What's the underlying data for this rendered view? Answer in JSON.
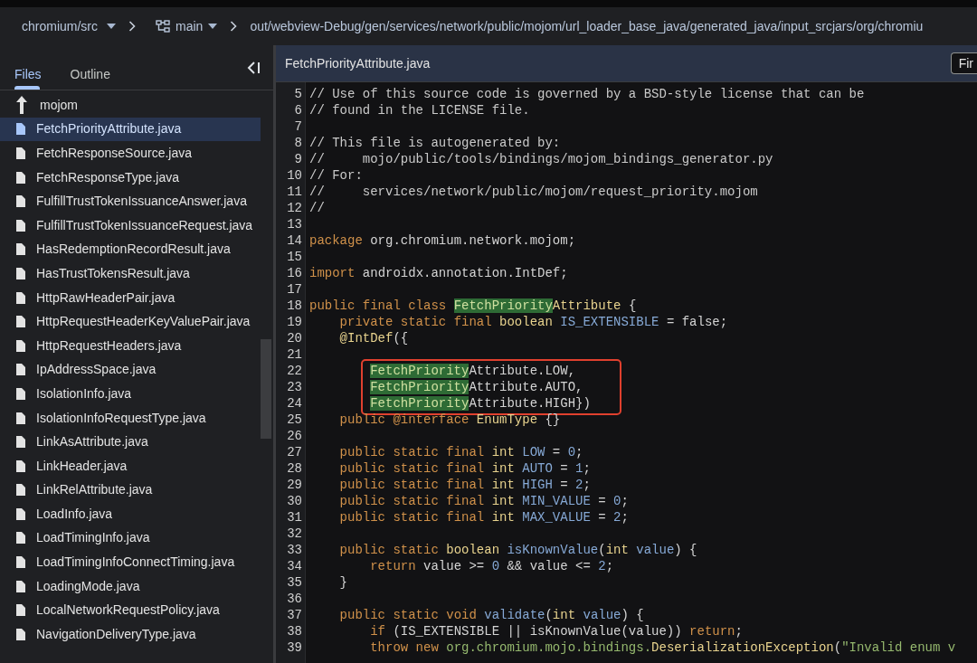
{
  "breadcrumb": {
    "repo": "chromium/src",
    "branch": "main",
    "path": "out/webview-Debug/gen/services/network/public/mojom/url_loader_base_java/generated_java/input_srcjars/org/chromiu"
  },
  "sidebar": {
    "tabs": [
      {
        "label": "Files",
        "selected": true
      },
      {
        "label": "Outline",
        "selected": false
      }
    ],
    "items": [
      {
        "name": "mojom",
        "kind": "parent",
        "selected": false
      },
      {
        "name": "FetchPriorityAttribute.java",
        "kind": "file",
        "selected": true
      },
      {
        "name": "FetchResponseSource.java",
        "kind": "file",
        "selected": false
      },
      {
        "name": "FetchResponseType.java",
        "kind": "file",
        "selected": false
      },
      {
        "name": "FulfillTrustTokenIssuanceAnswer.java",
        "kind": "file",
        "selected": false
      },
      {
        "name": "FulfillTrustTokenIssuanceRequest.java",
        "kind": "file",
        "selected": false
      },
      {
        "name": "HasRedemptionRecordResult.java",
        "kind": "file",
        "selected": false
      },
      {
        "name": "HasTrustTokensResult.java",
        "kind": "file",
        "selected": false
      },
      {
        "name": "HttpRawHeaderPair.java",
        "kind": "file",
        "selected": false
      },
      {
        "name": "HttpRequestHeaderKeyValuePair.java",
        "kind": "file",
        "selected": false
      },
      {
        "name": "HttpRequestHeaders.java",
        "kind": "file",
        "selected": false
      },
      {
        "name": "IpAddressSpace.java",
        "kind": "file",
        "selected": false
      },
      {
        "name": "IsolationInfo.java",
        "kind": "file",
        "selected": false
      },
      {
        "name": "IsolationInfoRequestType.java",
        "kind": "file",
        "selected": false
      },
      {
        "name": "LinkAsAttribute.java",
        "kind": "file",
        "selected": false
      },
      {
        "name": "LinkHeader.java",
        "kind": "file",
        "selected": false
      },
      {
        "name": "LinkRelAttribute.java",
        "kind": "file",
        "selected": false
      },
      {
        "name": "LoadInfo.java",
        "kind": "file",
        "selected": false
      },
      {
        "name": "LoadTimingInfo.java",
        "kind": "file",
        "selected": false
      },
      {
        "name": "LoadTimingInfoConnectTiming.java",
        "kind": "file",
        "selected": false
      },
      {
        "name": "LoadingMode.java",
        "kind": "file",
        "selected": false
      },
      {
        "name": "LocalNetworkRequestPolicy.java",
        "kind": "file",
        "selected": false
      },
      {
        "name": "NavigationDeliveryType.java",
        "kind": "file",
        "selected": false
      }
    ]
  },
  "editor": {
    "file_tab": "FetchPriorityAttribute.java",
    "find_button": "Fir",
    "lines": [
      {
        "n": "5",
        "boxed": false,
        "tokens": [
          {
            "t": "// Use of this source code is governed by a BSD-style license that can be",
            "kind": "comment"
          }
        ]
      },
      {
        "n": "6",
        "boxed": false,
        "tokens": [
          {
            "t": "// found in the LICENSE file.",
            "kind": "comment"
          }
        ]
      },
      {
        "n": "7",
        "boxed": false
      },
      {
        "n": "8",
        "boxed": false,
        "tokens": [
          {
            "t": "// This file is autogenerated by:",
            "kind": "comment"
          }
        ]
      },
      {
        "n": "9",
        "boxed": false,
        "tokens": [
          {
            "t": "//     mojo/public/tools/bindings/mojom_bindings_generator.py",
            "kind": "comment"
          }
        ]
      },
      {
        "n": "10",
        "boxed": false,
        "tokens": [
          {
            "t": "// For:",
            "kind": "comment"
          }
        ]
      },
      {
        "n": "11",
        "boxed": false,
        "tokens": [
          {
            "t": "//     services/network/public/mojom/request_priority.mojom",
            "kind": "comment"
          }
        ]
      },
      {
        "n": "12",
        "boxed": false,
        "tokens": [
          {
            "t": "//",
            "kind": "comment"
          }
        ]
      },
      {
        "n": "13",
        "boxed": false
      },
      {
        "n": "14",
        "boxed": false,
        "tokens": [
          {
            "t": "package",
            "kind": "keyword"
          },
          {
            "t": " org.chromium.network.mojom;",
            "kind": "plain"
          }
        ]
      },
      {
        "n": "15",
        "boxed": false
      },
      {
        "n": "16",
        "boxed": false,
        "tokens": [
          {
            "t": "import",
            "kind": "keyword"
          },
          {
            "t": " androidx.annotation.IntDef;",
            "kind": "plain"
          }
        ]
      },
      {
        "n": "17",
        "boxed": false
      },
      {
        "n": "18",
        "boxed": false,
        "tokens": [
          {
            "t": "public final class ",
            "kind": "keyword"
          },
          {
            "t": "FetchPriority",
            "kind": "match"
          },
          {
            "t": "Attribute",
            "kind": "type"
          },
          {
            "t": " {",
            "kind": "plain"
          }
        ]
      },
      {
        "n": "19",
        "boxed": false,
        "tokens": [
          {
            "t": "    private static final ",
            "kind": "keyword"
          },
          {
            "t": "boolean",
            "kind": "type"
          },
          {
            "t": " IS_EXTENSIBLE",
            "kind": "ident"
          },
          {
            "t": " = ",
            "kind": "plain"
          },
          {
            "t": "false",
            "kind": "plain"
          },
          {
            "t": ";",
            "kind": "plain"
          }
        ]
      },
      {
        "n": "20",
        "boxed": false,
        "tokens": [
          {
            "t": "    @IntDef",
            "kind": "type"
          },
          {
            "t": "({",
            "kind": "plain"
          }
        ]
      },
      {
        "n": "21",
        "boxed": false
      },
      {
        "n": "22",
        "boxed": true,
        "tokens": [
          {
            "t": "FetchPriority",
            "kind": "match"
          },
          {
            "t": "Attribute.LOW,",
            "kind": "plain"
          }
        ]
      },
      {
        "n": "23",
        "boxed": true,
        "tokens": [
          {
            "t": "FetchPriority",
            "kind": "match"
          },
          {
            "t": "Attribute.AUTO,",
            "kind": "plain"
          }
        ]
      },
      {
        "n": "24",
        "boxed": true,
        "tokens": [
          {
            "t": "FetchPriority",
            "kind": "match"
          },
          {
            "t": "Attribute.HIGH})",
            "kind": "plain"
          }
        ]
      },
      {
        "n": "25",
        "boxed": false,
        "tokens": [
          {
            "t": "    public @interface ",
            "kind": "keyword"
          },
          {
            "t": "EnumType",
            "kind": "type"
          },
          {
            "t": " {}",
            "kind": "plain"
          }
        ]
      },
      {
        "n": "26",
        "boxed": false
      },
      {
        "n": "27",
        "boxed": false,
        "tokens": [
          {
            "t": "    public static final ",
            "kind": "keyword"
          },
          {
            "t": "int",
            "kind": "type"
          },
          {
            "t": " LOW",
            "kind": "ident"
          },
          {
            "t": " = ",
            "kind": "plain"
          },
          {
            "t": "0",
            "kind": "number"
          },
          {
            "t": ";",
            "kind": "plain"
          }
        ]
      },
      {
        "n": "28",
        "boxed": false,
        "tokens": [
          {
            "t": "    public static final ",
            "kind": "keyword"
          },
          {
            "t": "int",
            "kind": "type"
          },
          {
            "t": " AUTO",
            "kind": "ident"
          },
          {
            "t": " = ",
            "kind": "plain"
          },
          {
            "t": "1",
            "kind": "number"
          },
          {
            "t": ";",
            "kind": "plain"
          }
        ]
      },
      {
        "n": "29",
        "boxed": false,
        "tokens": [
          {
            "t": "    public static final ",
            "kind": "keyword"
          },
          {
            "t": "int",
            "kind": "type"
          },
          {
            "t": " HIGH",
            "kind": "ident"
          },
          {
            "t": " = ",
            "kind": "plain"
          },
          {
            "t": "2",
            "kind": "number"
          },
          {
            "t": ";",
            "kind": "plain"
          }
        ]
      },
      {
        "n": "30",
        "boxed": false,
        "tokens": [
          {
            "t": "    public static final ",
            "kind": "keyword"
          },
          {
            "t": "int",
            "kind": "type"
          },
          {
            "t": " MIN_VALUE",
            "kind": "ident"
          },
          {
            "t": " = ",
            "kind": "plain"
          },
          {
            "t": "0",
            "kind": "number"
          },
          {
            "t": ";",
            "kind": "plain"
          }
        ]
      },
      {
        "n": "31",
        "boxed": false,
        "tokens": [
          {
            "t": "    public static final ",
            "kind": "keyword"
          },
          {
            "t": "int",
            "kind": "type"
          },
          {
            "t": " MAX_VALUE",
            "kind": "ident"
          },
          {
            "t": " = ",
            "kind": "plain"
          },
          {
            "t": "2",
            "kind": "number"
          },
          {
            "t": ";",
            "kind": "plain"
          }
        ]
      },
      {
        "n": "32",
        "boxed": false
      },
      {
        "n": "33",
        "boxed": false,
        "tokens": [
          {
            "t": "    public static ",
            "kind": "keyword"
          },
          {
            "t": "boolean",
            "kind": "type"
          },
          {
            "t": " isKnownValue",
            "kind": "ident"
          },
          {
            "t": "(",
            "kind": "plain"
          },
          {
            "t": "int",
            "kind": "type"
          },
          {
            "t": " value",
            "kind": "ident"
          },
          {
            "t": ") {",
            "kind": "plain"
          }
        ]
      },
      {
        "n": "34",
        "boxed": false,
        "tokens": [
          {
            "t": "        return",
            "kind": "keyword"
          },
          {
            "t": " value >= ",
            "kind": "plain"
          },
          {
            "t": "0",
            "kind": "number"
          },
          {
            "t": " && value <= ",
            "kind": "plain"
          },
          {
            "t": "2",
            "kind": "number"
          },
          {
            "t": ";",
            "kind": "plain"
          }
        ]
      },
      {
        "n": "35",
        "boxed": false,
        "tokens": [
          {
            "t": "    }",
            "kind": "plain"
          }
        ]
      },
      {
        "n": "36",
        "boxed": false
      },
      {
        "n": "37",
        "boxed": false,
        "tokens": [
          {
            "t": "    public static void ",
            "kind": "keyword"
          },
          {
            "t": "validate",
            "kind": "ident"
          },
          {
            "t": "(",
            "kind": "plain"
          },
          {
            "t": "int",
            "kind": "type"
          },
          {
            "t": " value",
            "kind": "ident"
          },
          {
            "t": ") {",
            "kind": "plain"
          }
        ]
      },
      {
        "n": "38",
        "boxed": false,
        "tokens": [
          {
            "t": "        if",
            "kind": "keyword"
          },
          {
            "t": " (IS_EXTENSIBLE || isKnownValue(value)) ",
            "kind": "plain"
          },
          {
            "t": "return",
            "kind": "keyword"
          },
          {
            "t": ";",
            "kind": "plain"
          }
        ]
      },
      {
        "n": "39",
        "boxed": false,
        "tokens": [
          {
            "t": "        throw new ",
            "kind": "keyword"
          },
          {
            "t": "org.chromium.mojo.bindings.",
            "kind": "string"
          },
          {
            "t": "DeserializationException",
            "kind": "type"
          },
          {
            "t": "(",
            "kind": "plain"
          },
          {
            "t": "\"Invalid enum v",
            "kind": "string"
          }
        ]
      }
    ]
  }
}
